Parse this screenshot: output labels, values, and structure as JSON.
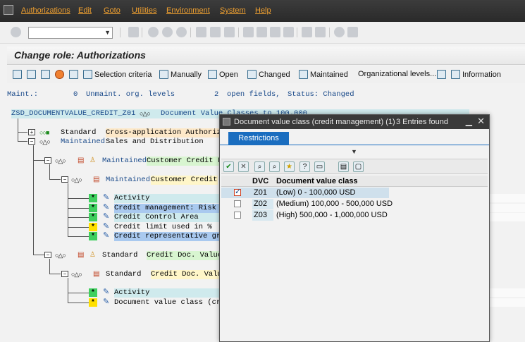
{
  "menubar": {
    "items": [
      "Authorizations",
      "Edit",
      "Goto",
      "Utilities",
      "Environment",
      "System",
      "Help"
    ]
  },
  "toolbar": {
    "command_value": ""
  },
  "title": "Change role: Authorizations",
  "app_toolbar": {
    "selection_criteria": "Selection criteria",
    "manually": "Manually",
    "open": "Open",
    "changed": "Changed",
    "maintained": "Maintained",
    "org_levels": "Organizational levels...",
    "information": "Information"
  },
  "status": {
    "maint_label": "Maint.:",
    "unmaint_count": "0",
    "unmaint_text": "Unmaint. org. levels",
    "open_count": "2",
    "open_text": "open fields,",
    "status_label": "Status: Changed"
  },
  "tree": {
    "root_id": "ZSD_DOCUMENTVALUE_CREDIT_Z01",
    "root_text": "Document Value Classes to 100.000",
    "node1_status": "Standard",
    "node1_text": "Cross-application Authoriza",
    "node2_status": "Maintained",
    "node2_text": "Sales and Distribution",
    "node3_status": "Maintained",
    "node3_text": "Customer Credit L",
    "node4_status": "Maintained",
    "node4_text": "Customer Credit",
    "fields_a": [
      {
        "flag": "*",
        "text": "Activity"
      },
      {
        "flag": "*",
        "text": "Credit management: Risk c"
      },
      {
        "flag": "*",
        "text": "Credit Control Area"
      },
      {
        "flag": "*",
        "text": "Credit limit used in %"
      },
      {
        "flag": "*",
        "text": "Credit representative gro"
      }
    ],
    "node5_status": "Standard",
    "node5_text": "Credit Doc. Value",
    "node6_status": "Standard",
    "node6_text": "Credit Doc. Valu",
    "fields_b": [
      {
        "flag": "*",
        "text": "Activity"
      },
      {
        "flag": "*",
        "text": "Document value class (cre"
      }
    ]
  },
  "popup": {
    "title": "Document value class (credit management) (1)",
    "entries_found": "3 Entries found",
    "tab": "Restrictions",
    "col_dvc": "DVC",
    "col_desc": "Document value class",
    "rows": [
      {
        "dvc": "Z01",
        "desc": "(Low) 0 - 100,000 USD",
        "checked": true
      },
      {
        "dvc": "Z02",
        "desc": "(Medium) 100,000 - 500,000 USD",
        "checked": false
      },
      {
        "dvc": "Z03",
        "desc": "(High) 500,000 - 1,000,000 USD",
        "checked": false
      }
    ]
  },
  "colors": {
    "menu_text": "#f0a030",
    "accent_blue": "#1a6dbf",
    "status_blue": "#1a4a8a"
  }
}
